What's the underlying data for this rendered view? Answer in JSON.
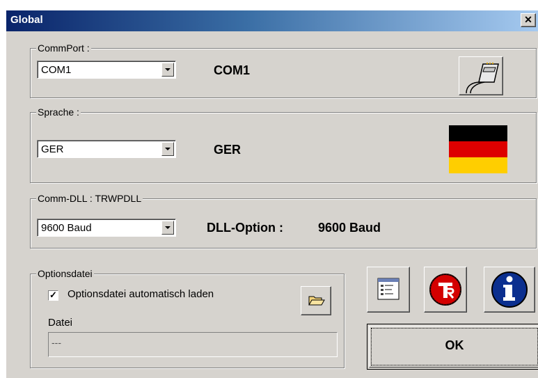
{
  "window": {
    "title": "Global",
    "close_glyph": "✕"
  },
  "commport": {
    "legend": "CommPort :",
    "selected": "COM1",
    "status": "COM1",
    "icon": "serial-cable-icon"
  },
  "sprache": {
    "legend": "Sprache :",
    "selected": "GER",
    "status": "GER",
    "flag_colors": [
      "#000000",
      "#dd0000",
      "#ffce00"
    ]
  },
  "commdll": {
    "legend": "Comm-DLL : TRWPDLL",
    "selected": "9600 Baud",
    "status_label": "DLL-Option :",
    "status_value": "9600 Baud"
  },
  "options": {
    "legend": "Optionsdatei",
    "autoload_checked": true,
    "autoload_label": "Optionsdatei automatisch laden",
    "datei_label": "Datei",
    "datei_value": "---"
  },
  "buttons": {
    "ok_label": "OK",
    "settings_icon": "window-settings-icon",
    "logo_icon": "tr-logo-icon",
    "info_icon": "info-icon",
    "folder_icon": "open-folder-icon"
  },
  "colors": {
    "dialog_bg": "#d6d3ce",
    "titlebar_start": "#0a246a",
    "titlebar_end": "#a6caf0",
    "logo_red": "#d40000",
    "info_blue": "#0b2f8f"
  }
}
